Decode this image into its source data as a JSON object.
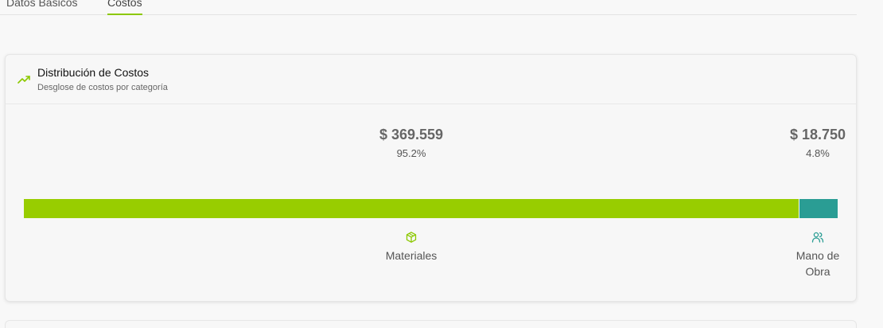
{
  "tabs": [
    {
      "label": "Datos Básicos"
    },
    {
      "label": "Costos"
    }
  ],
  "card": {
    "title": "Distribución de Costos",
    "subtitle": "Desglose de costos por categoría",
    "icon": "trending-up-icon"
  },
  "categories": [
    {
      "name": "Materiales",
      "amount": "$ 369.559",
      "percent_label": "95.2%",
      "percent": 95.2,
      "color": "#98cd00",
      "icon": "package-icon"
    },
    {
      "name": "Mano de Obra",
      "amount": "$ 18.750",
      "percent_label": "4.8%",
      "percent": 4.8,
      "color": "#2a9d94",
      "icon": "users-icon"
    }
  ],
  "colors": {
    "accent": "#8cc800"
  }
}
